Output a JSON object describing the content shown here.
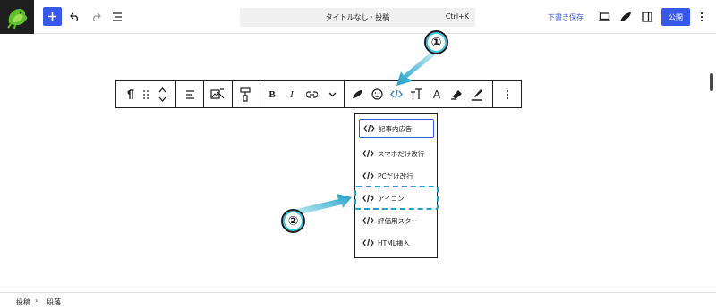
{
  "topbar": {
    "command_bar": {
      "title": "タイトルなし · 投稿",
      "shortcut": "Ctrl+K"
    },
    "save_draft": "下書き保存",
    "publish": "公開"
  },
  "block_toolbar": {
    "buttons": [
      "paragraph-icon",
      "drag-handle-icon",
      "move-up-down-icon",
      "align-left-icon",
      "image-text-icon",
      "paint-roller-icon",
      "bold-icon",
      "italic-icon",
      "link-icon",
      "chevron-down-icon",
      "swell-icon",
      "smiley-icon",
      "code-icon",
      "text-size-icon",
      "text-color-icon",
      "highlighter-icon",
      "marker-icon",
      "more-options-icon"
    ]
  },
  "dropdown": {
    "items": [
      {
        "label": "記事内広告"
      },
      {
        "label": "スマホだけ改行"
      },
      {
        "label": "PCだけ改行"
      },
      {
        "label": "アイコン"
      },
      {
        "label": "評価用スター"
      },
      {
        "label": "HTML挿入"
      }
    ]
  },
  "annotations": {
    "step1": "①",
    "step2": "②",
    "colors": {
      "accent": "#1ea0c8",
      "circle_ring": "#3cc6e6"
    }
  },
  "breadcrumb": {
    "items": [
      "投稿",
      "段落"
    ]
  },
  "colors": {
    "primary": "#3858e9",
    "text": "#1e1e1e"
  }
}
